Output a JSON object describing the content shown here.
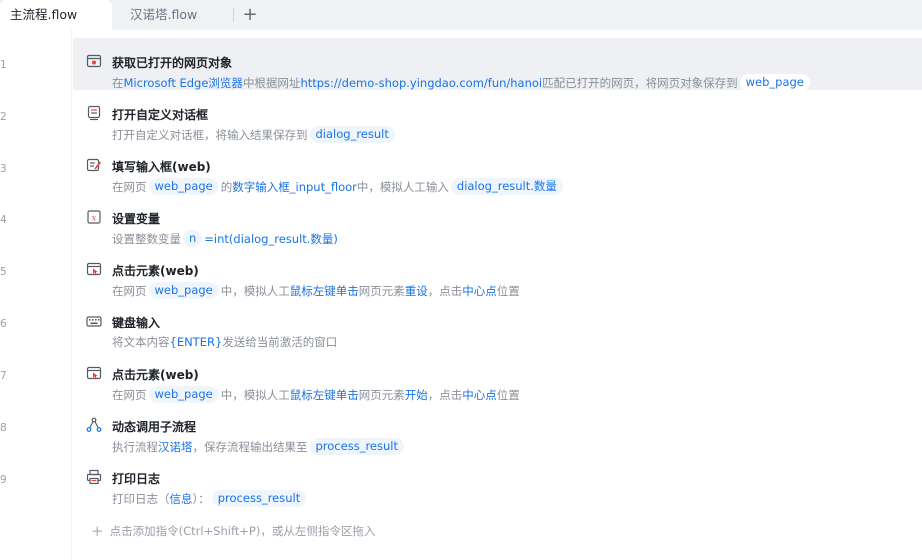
{
  "tabs": [
    {
      "label": "主流程.flow",
      "active": true
    },
    {
      "label": "汉诺塔.flow",
      "active": false
    }
  ],
  "add_tab_symbol": "+",
  "steps": [
    {
      "line": "1",
      "icon": "browser-open-icon",
      "title": "获取已打开的网页对象",
      "desc": {
        "t1": "在",
        "browser": "Microsoft Edge浏览器",
        "t2": "中根据网址",
        "url": "https://demo-shop.yingdao.com/fun/hanoi",
        "t3": "匹配已打开的网页，将网页对象保存到",
        "var": "web_page"
      }
    },
    {
      "line": "2",
      "icon": "dialog-icon",
      "title": "打开自定义对话框",
      "desc": {
        "t1": "打开自定义对话框，将输入结果保存到",
        "var": "dialog_result"
      }
    },
    {
      "line": "3",
      "icon": "form-input-icon",
      "title": "填写输入框(web)",
      "desc": {
        "t1": "在网页",
        "var1": "web_page",
        "t2": "的",
        "element": "数字输入框_input_floor",
        "t3": "中，模拟人工输入",
        "var2": "dialog_result.数量"
      }
    },
    {
      "line": "4",
      "icon": "variable-icon",
      "title": "设置变量",
      "desc": {
        "t1": "设置整数变量",
        "var": "n",
        "expr": "=int(dialog_result.数量)"
      }
    },
    {
      "line": "5",
      "icon": "click-element-icon",
      "title": "点击元素(web)",
      "desc": {
        "t1": "在网页",
        "var": "web_page",
        "t2": "中，模拟人工",
        "action": "鼠标左键单击",
        "t3": "网页元素",
        "element": "重设",
        "t4": "，点击",
        "pos": "中心点",
        "t5": "位置"
      }
    },
    {
      "line": "6",
      "icon": "keyboard-icon",
      "title": "键盘输入",
      "desc": {
        "t1": "将文本内容",
        "key": "{ENTER}",
        "t2": "发送给当前激活的窗口"
      }
    },
    {
      "line": "7",
      "icon": "click-element-icon",
      "title": "点击元素(web)",
      "desc": {
        "t1": "在网页",
        "var": "web_page",
        "t2": "中，模拟人工",
        "action": "鼠标左键单击",
        "t3": "网页元素",
        "element": "开始",
        "t4": "，点击",
        "pos": "中心点",
        "t5": "位置"
      }
    },
    {
      "line": "8",
      "icon": "subflow-icon",
      "title": "动态调用子流程",
      "desc": {
        "t1": "执行流程",
        "flow": "汉诺塔",
        "t2": "，保存流程输出结果至",
        "var": "process_result"
      }
    },
    {
      "line": "9",
      "icon": "print-log-icon",
      "title": "打印日志",
      "desc": {
        "t1": "打印日志（",
        "level": "信息",
        "t2": "）：",
        "var": "process_result"
      }
    }
  ],
  "add_command": {
    "plus": "+",
    "label": "点击添加指令(Ctrl+Shift+P)，或从左侧指令区拖入"
  },
  "colors": {
    "accent": "#1a73e8",
    "icon_red": "#e8453c",
    "selected_bg": "#eef0f4"
  }
}
